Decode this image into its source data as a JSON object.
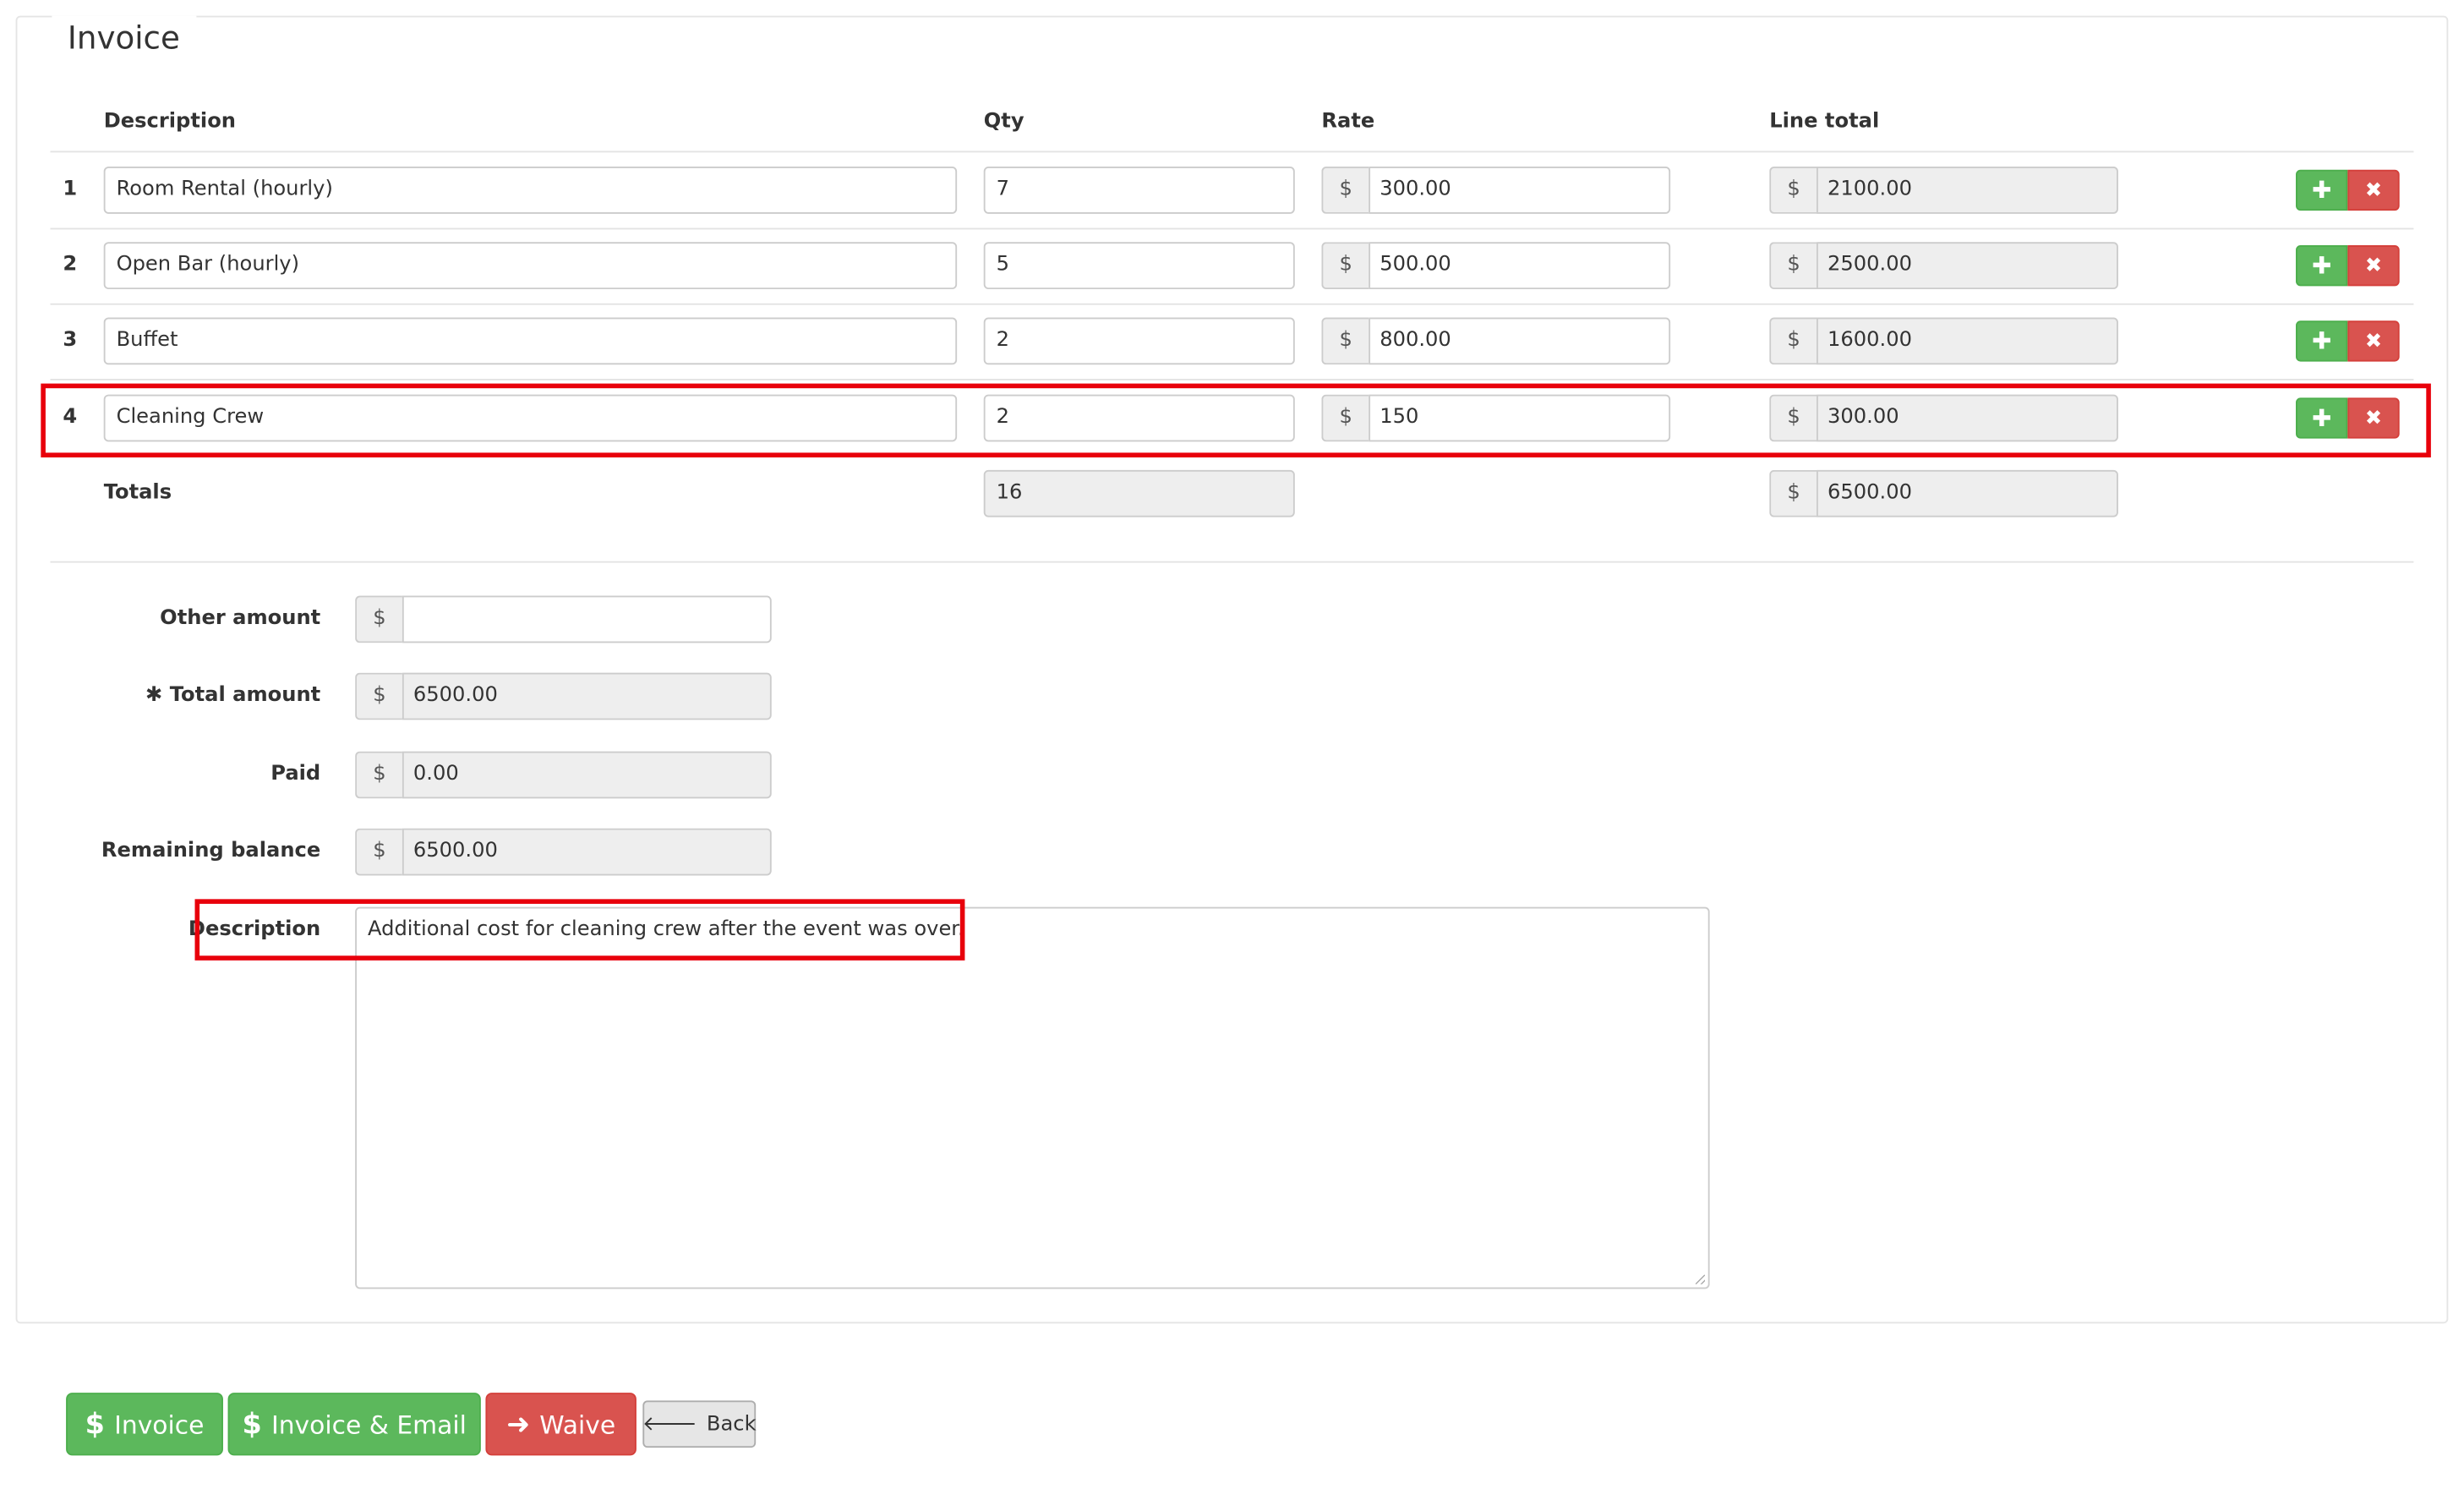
{
  "invoice": {
    "title": "Invoice",
    "columns": {
      "description": "Description",
      "qty": "Qty",
      "rate": "Rate",
      "line_total": "Line total"
    },
    "currency": "$",
    "rows": [
      {
        "num": "1",
        "description": "Room Rental (hourly)",
        "qty": "7",
        "rate": "300.00",
        "line_total": "2100.00"
      },
      {
        "num": "2",
        "description": "Open Bar (hourly)",
        "qty": "5",
        "rate": "500.00",
        "line_total": "2500.00"
      },
      {
        "num": "3",
        "description": "Buffet",
        "qty": "2",
        "rate": "800.00",
        "line_total": "1600.00"
      },
      {
        "num": "4",
        "description": "Cleaning Crew",
        "qty": "2",
        "rate": "150",
        "line_total": "300.00"
      }
    ],
    "totals": {
      "label": "Totals",
      "qty": "16",
      "line_total": "6500.00"
    }
  },
  "summary": {
    "other_amount": {
      "label": "Other amount",
      "value": ""
    },
    "total_amount": {
      "required_mark": "✱",
      "label": "Total amount",
      "value": "6500.00"
    },
    "paid": {
      "label": "Paid",
      "value": "0.00"
    },
    "remaining_balance": {
      "label": "Remaining balance",
      "value": "6500.00"
    },
    "description": {
      "label": "Description",
      "value": "Additional cost for cleaning crew after the event was over."
    }
  },
  "actions": {
    "invoice": {
      "icon": "$",
      "label": "Invoice"
    },
    "invoice_email": {
      "icon": "$",
      "label": "Invoice & Email"
    },
    "waive": {
      "icon": "➜",
      "label": "Waive"
    },
    "back": {
      "icon": "🡐",
      "label": "Back"
    }
  },
  "icons": {
    "add": "plus-icon",
    "remove": "times-icon",
    "arrow": "arrow-right-icon",
    "back": "arrow-left-icon"
  },
  "colors": {
    "success": "#5cb85c",
    "danger": "#d9534f",
    "highlight": "#e8000b"
  }
}
